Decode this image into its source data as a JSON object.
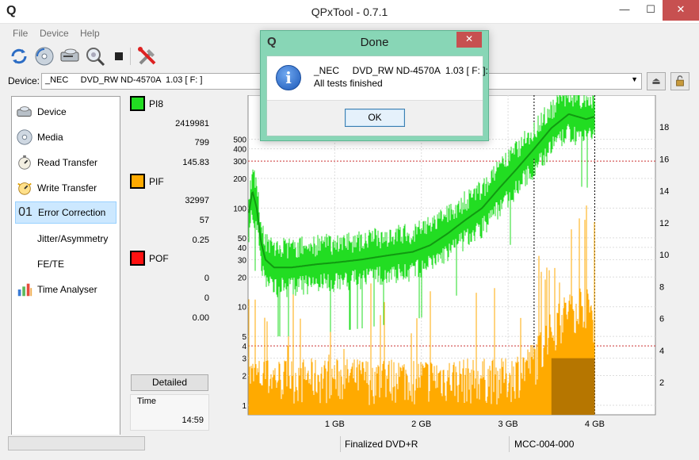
{
  "window": {
    "title": "QPxTool - 0.7.1",
    "app_icon": "Q",
    "min": "—",
    "max": "☐",
    "close": "✕"
  },
  "menu": [
    "File",
    "Device",
    "Help"
  ],
  "toolbar": {
    "buttons": [
      "refresh-icon",
      "media-icon",
      "drive-icon",
      "scan-icon",
      "stop-icon",
      "tools-icon"
    ]
  },
  "device": {
    "label": "Device:",
    "value": "_NEC     DVD_RW ND-4570A  1.03 [ F: ]",
    "eject_icon": "⏏",
    "lock_icon": "🔓"
  },
  "sidebar": {
    "items": [
      {
        "label": "Device",
        "icon": "drive-icon"
      },
      {
        "label": "Media",
        "icon": "disc-icon"
      },
      {
        "label": "Read Transfer",
        "icon": "read-transfer-icon"
      },
      {
        "label": "Write Transfer",
        "icon": "write-transfer-icon"
      },
      {
        "label": "Error Correction",
        "icon": "error-correction-icon",
        "prefix": "01",
        "active": true
      },
      {
        "label": "Jitter/Asymmetry",
        "icon": ""
      },
      {
        "label": "FE/TE",
        "icon": ""
      },
      {
        "label": "Time Analyser",
        "icon": "bar-chart-icon"
      }
    ]
  },
  "stats": {
    "pi8": {
      "label": "PI8",
      "color": "#22dd22",
      "total": "2419981",
      "max": "799",
      "avg": "145.83"
    },
    "pif": {
      "label": "PIF",
      "color": "#ffaa00",
      "total": "32997",
      "max": "57",
      "avg": "0.25"
    },
    "pof": {
      "label": "POF",
      "color": "#ff1111",
      "total": "0",
      "max": "0",
      "avg": "0.00"
    },
    "detailed_label": "Detailed",
    "time_label": "Time",
    "time_value": "14:59"
  },
  "chart_data": {
    "type": "area",
    "x_unit": "GB",
    "x_ticks": [
      "1 GB",
      "2 GB",
      "3 GB",
      "4 GB"
    ],
    "x_range": [
      0,
      4.7
    ],
    "y_left_ticks": [
      "500",
      "400",
      "300",
      "200",
      "100",
      "50",
      "40",
      "30",
      "20",
      "10",
      "5",
      "4",
      "3",
      "2",
      "1"
    ],
    "y_left_scale": "log",
    "y_right_ticks": [
      "18",
      "16",
      "14",
      "12",
      "10",
      "8",
      "6",
      "4",
      "2"
    ],
    "grid": true,
    "series": [
      {
        "name": "PI8",
        "color": "#22dd22",
        "x": [
          0,
          0.05,
          0.1,
          0.15,
          0.2,
          0.3,
          0.5,
          0.8,
          1.0,
          1.3,
          1.6,
          1.9,
          2.1,
          2.3,
          2.5,
          2.7,
          2.9,
          3.1,
          3.3,
          3.5,
          3.7,
          3.9,
          4.0
        ],
        "values": [
          80,
          150,
          100,
          45,
          30,
          25,
          25,
          27,
          28,
          30,
          33,
          36,
          42,
          55,
          75,
          100,
          160,
          250,
          400,
          650,
          900,
          800,
          850
        ]
      },
      {
        "name": "PIF",
        "color": "#ffaa00",
        "x": [
          0,
          0.5,
          1.0,
          1.5,
          2.0,
          2.5,
          3.0,
          3.3,
          3.5,
          3.7,
          3.9,
          4.0
        ],
        "values": [
          2,
          2,
          2,
          2,
          2,
          2,
          2,
          3,
          6,
          10,
          12,
          8
        ]
      }
    ]
  },
  "status": {
    "media_type": "Finalized DVD+R",
    "media_id": "MCC-004-000"
  },
  "dialog": {
    "title": "Done",
    "app_icon": "Q",
    "close": "✕",
    "line1": "_NEC     DVD_RW ND-4570A  1.03 [ F: ]:",
    "line2": "All tests finished",
    "info_glyph": "i",
    "ok_label": "OK"
  }
}
